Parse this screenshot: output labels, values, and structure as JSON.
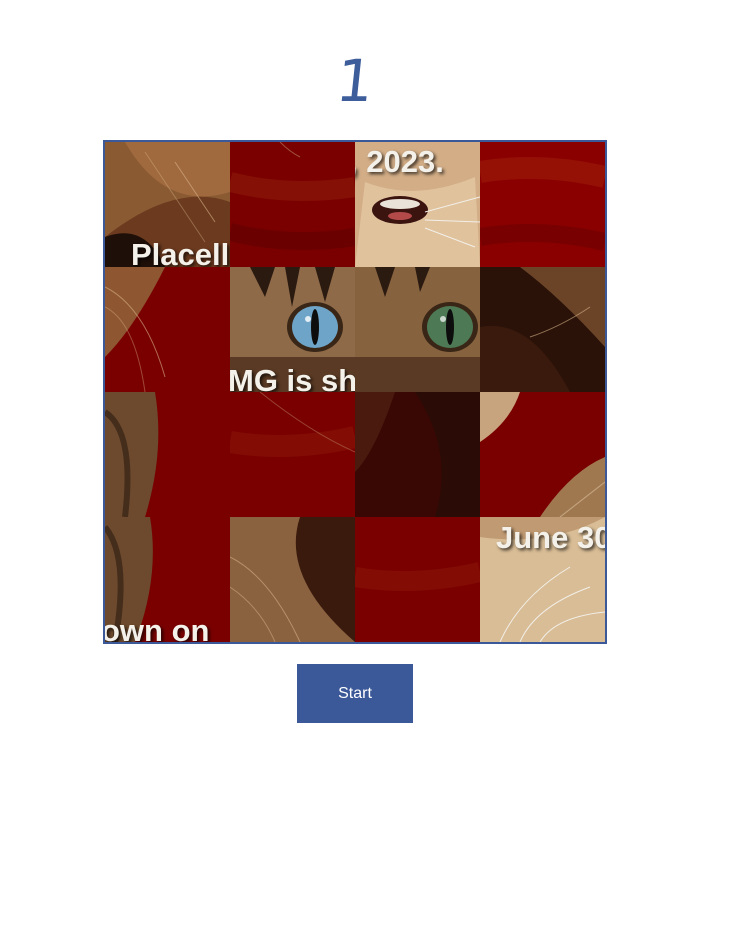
{
  "counter": "1",
  "start_label": "Start",
  "colors": {
    "accent": "#3b5998",
    "counter": "#3d5d9b",
    "tile_red": "#7a0000"
  },
  "puzzle": {
    "grid": "4x4",
    "tile_texts": [
      "Placell",
      ", 2023.",
      "MG is shutting do",
      "June 30",
      "own on"
    ]
  }
}
